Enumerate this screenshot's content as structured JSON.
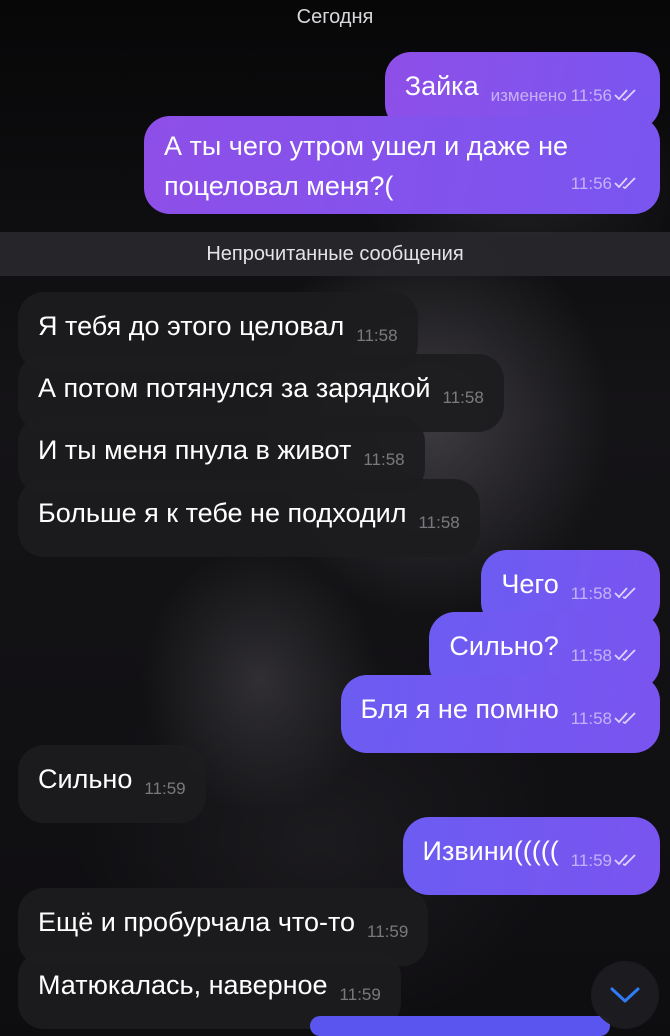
{
  "date_header": "Сегодня",
  "unread_separator": "Непрочитанные сообщения",
  "messages": [
    {
      "text": "Зайка",
      "edited": "изменено",
      "time": "11:56"
    },
    {
      "text": "А ты чего утром ушел и даже не поцеловал меня?(",
      "time": "11:56"
    },
    {
      "text": "Я тебя до этого целовал",
      "time": "11:58"
    },
    {
      "text": "А потом потянулся за зарядкой",
      "time": "11:58"
    },
    {
      "text": "И ты меня пнула в живот",
      "time": "11:58"
    },
    {
      "text": "Больше я к тебе не подходил",
      "time": "11:58"
    },
    {
      "text": "Чего",
      "time": "11:58"
    },
    {
      "text": "Сильно?",
      "time": "11:58"
    },
    {
      "text": "Бля я не помню",
      "time": "11:58"
    },
    {
      "text": "Сильно",
      "time": "11:59"
    },
    {
      "text": "Извини(((((",
      "time": "11:59"
    },
    {
      "text": "Ещё и пробурчала что-то",
      "time": "11:59"
    },
    {
      "text": "Матюкалась, наверное",
      "time": "11:59"
    }
  ],
  "colors": {
    "outgoing_bubble": "#8e4fe8",
    "outgoing_bubble_alt": "#6c5cf2",
    "incoming_bubble": "#1c1c1e",
    "unread_bar": "#28282c",
    "scroll_chevron": "#2f7cf6"
  },
  "icons": {
    "read_receipt": "double-check-icon",
    "scroll_down": "chevron-down-icon"
  }
}
